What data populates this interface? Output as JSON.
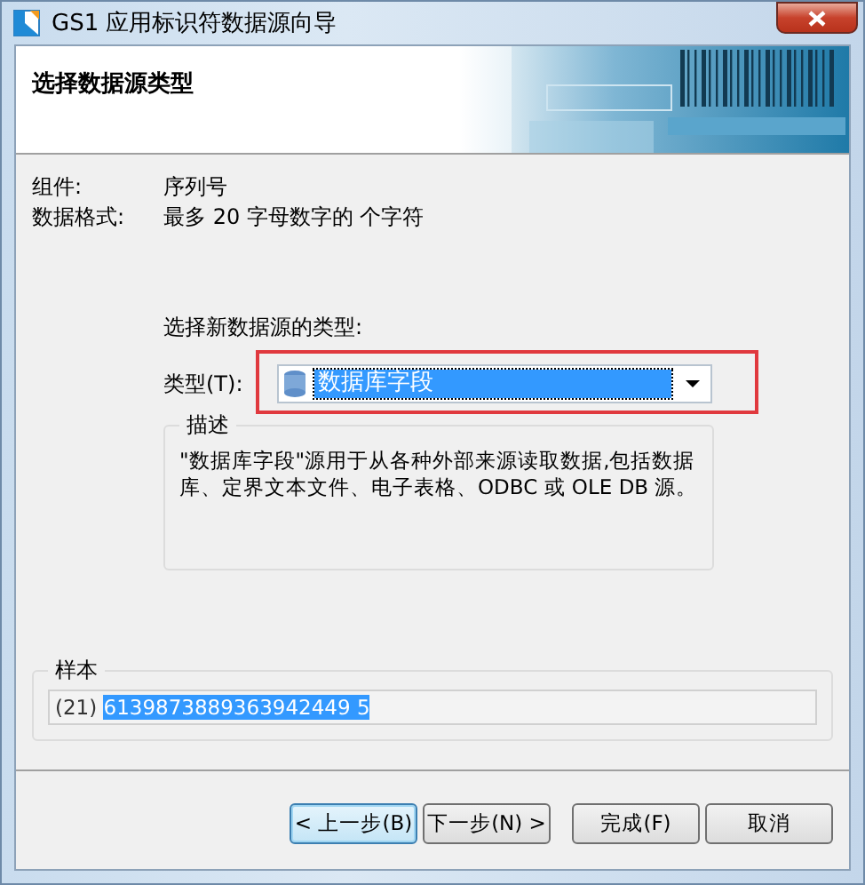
{
  "window": {
    "title": "GS1 应用标识符数据源向导"
  },
  "header": {
    "title": "选择数据源类型"
  },
  "info": [
    {
      "label": "组件:",
      "value": "序列号"
    },
    {
      "label": "数据格式:",
      "value": "最多 20 字母数字的 个字符"
    }
  ],
  "source": {
    "prompt": "选择新数据源的类型:",
    "label": "类型(T):",
    "value": "数据库字段",
    "selected": true,
    "highlighted": true
  },
  "description": {
    "title": "描述",
    "text": "\"数据库字段\"源用于从各种外部来源读取数据,包括数据库、定界文本文件、电子表格、ODBC 或 OLE DB 源。"
  },
  "sample": {
    "title": "样本",
    "prefix": "(21) ",
    "value": "6139873889363942449 5"
  },
  "buttons": [
    {
      "label": "< 上一步(B)",
      "default": true
    },
    {
      "label": "下一步(N) >",
      "default": false
    },
    {
      "label": "完成(F)",
      "default": false
    },
    {
      "label": "取消",
      "default": false
    }
  ]
}
